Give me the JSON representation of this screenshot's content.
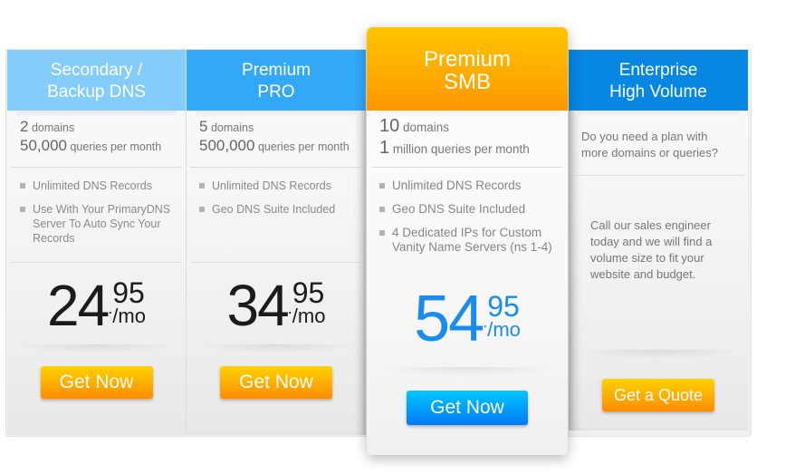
{
  "plans": [
    {
      "title_line1": "Secondary /",
      "title_line2": "Backup DNS",
      "header_color": "#84ccf9",
      "domains_count": "2",
      "domains_label": "domains",
      "queries_count": "50,000",
      "queries_label": "queries per month",
      "features": [
        "Unlimited DNS Records",
        "Use With Your PrimaryDNS Server To Auto Sync Your Records"
      ],
      "price_whole": "24",
      "price_dot": ".",
      "price_cents": "95",
      "price_period": "/mo",
      "button_label": "Get Now"
    },
    {
      "title_line1": "Premium",
      "title_line2": "PRO",
      "header_color": "#32a8f7",
      "domains_count": "5",
      "domains_label": "domains",
      "queries_count": "500,000",
      "queries_label": "queries per month",
      "features": [
        "Unlimited DNS Records",
        "Geo DNS Suite Included"
      ],
      "price_whole": "34",
      "price_dot": ".",
      "price_cents": "95",
      "price_period": "/mo",
      "button_label": "Get Now"
    },
    {
      "title_line1": "Premium",
      "title_line2": "SMB",
      "header_color": "#ffb300",
      "featured": true,
      "domains_count": "10",
      "domains_label": "domains",
      "queries_count": "1",
      "queries_label": "million queries per month",
      "features": [
        "Unlimited DNS Records",
        "Geo DNS Suite Included",
        "4 Dedicated IPs for Custom Vanity Name Servers (ns 1-4)"
      ],
      "price_whole": "54",
      "price_dot": ".",
      "price_cents": "95",
      "price_period": "/mo",
      "price_color": "#1a8cf0",
      "button_label": "Get Now"
    },
    {
      "title_line1": "Enterprise",
      "title_line2": "High Volume",
      "header_color": "#0787e2",
      "question": "Do you need a plan with more domains or queries?",
      "body": "Call our sales engineer today and we will find a volume size to fit your website and budget.",
      "button_label": "Get a Quote"
    }
  ],
  "colors": {
    "button_orange_top": "#ffd200",
    "button_orange_bottom": "#ff8c00",
    "button_blue_top": "#00c8ff",
    "button_blue_bottom": "#0079f5"
  }
}
